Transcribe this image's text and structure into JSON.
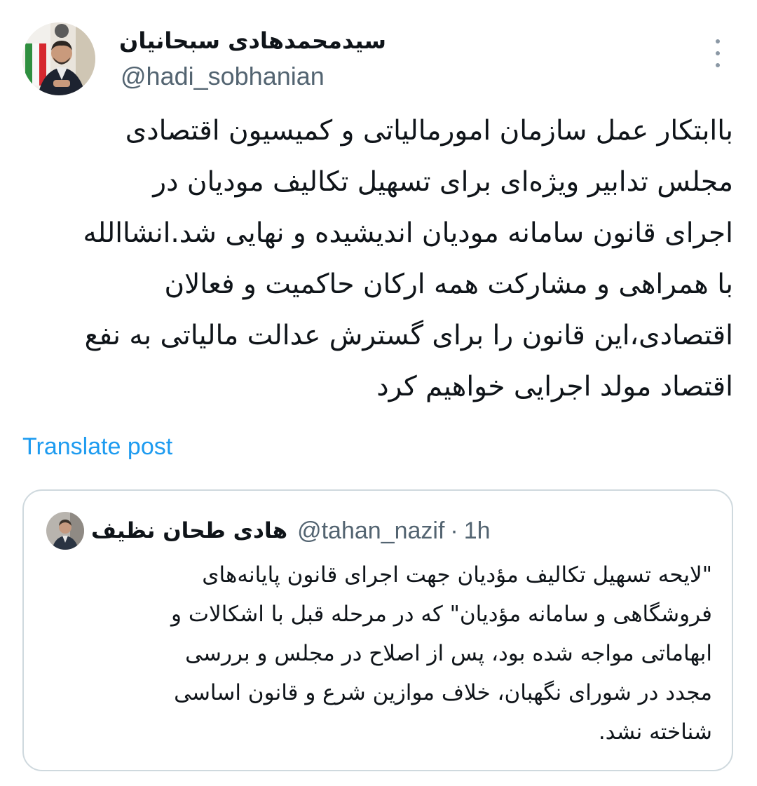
{
  "post": {
    "author": {
      "display_name": "سیدمحمدهادی سبحانیان",
      "handle": "@hadi_sobhanian"
    },
    "body_lines": [
      "باابتکار عمل سازمان امورمالیاتی و کمیسیون اقتصادی",
      "مجلس تدابیر ویژه‌ای برای تسهیل تکالیف مودیان در",
      "اجرای قانون سامانه مودیان اندیشیده و نهایی شد.انشاالله",
      "با همراهی و مشارکت همه ارکان حاکمیت و فعالان",
      "اقتصادی،این قانون را برای گسترش عدالت مالیاتی به نفع",
      "اقتصاد مولد اجرایی خواهیم کرد"
    ],
    "translate_label": "Translate post",
    "more_icon": "more-vertical-icon"
  },
  "quote": {
    "display_name": "هادی طحان نظیف",
    "handle": "@tahan_nazif",
    "separator": "·",
    "time": "1h",
    "body_lines": [
      "\"لایحه تسهیل تکالیف مؤدیان جهت اجرای قانون پایانه‌های",
      "فروشگاهی و سامانه مؤدیان\" که در مرحله قبل با اشکالات و",
      "ابهاماتی مواجه شده بود، پس از اصلاح در مجلس و بررسی",
      "مجدد در شورای نگهبان، خلاف موازین شرع و قانون اساسی",
      "شناخته نشد."
    ]
  },
  "colors": {
    "text_primary": "#0f1419",
    "text_secondary": "#536471",
    "link": "#1d9bf0",
    "border": "#cfd9de"
  }
}
